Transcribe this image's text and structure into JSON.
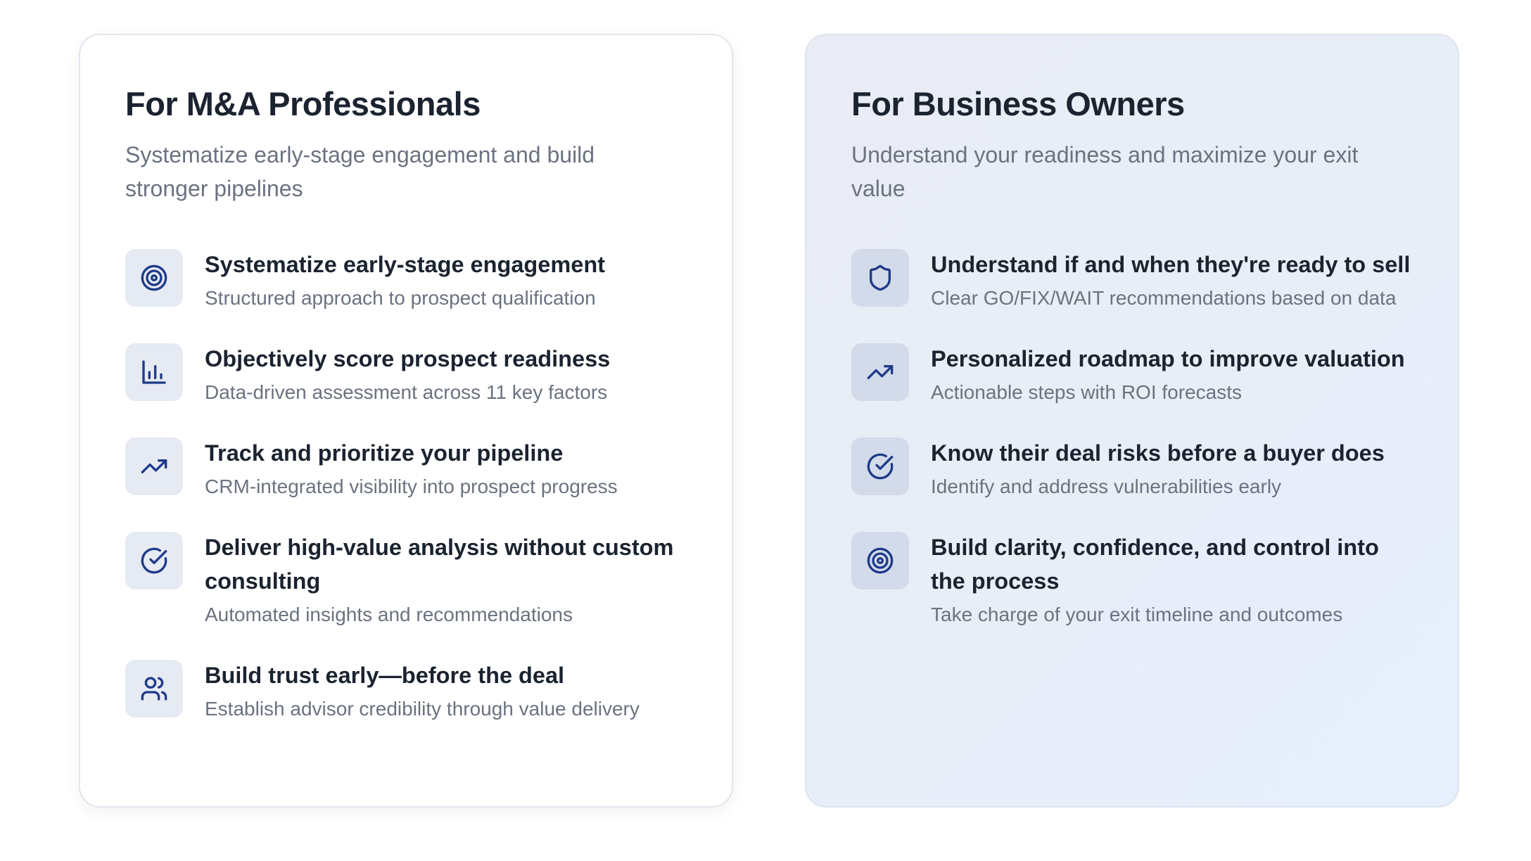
{
  "colors": {
    "icon": "#1e3a8a",
    "title": "#1b2330",
    "muted": "#6b7280",
    "border": "#e2e6ee"
  },
  "professionals": {
    "title": "For M&A Professionals",
    "subtitle": "Systematize early-stage engagement and build stronger pipelines",
    "features": [
      {
        "icon": "target-icon",
        "title": "Systematize early-stage engagement",
        "description": "Structured approach to prospect qualification"
      },
      {
        "icon": "bar-chart-icon",
        "title": "Objectively score prospect readiness",
        "description": "Data-driven assessment across 11 key factors"
      },
      {
        "icon": "trending-up-icon",
        "title": "Track and prioritize your pipeline",
        "description": "CRM-integrated visibility into prospect progress"
      },
      {
        "icon": "check-circle-icon",
        "title": "Deliver high-value analysis without custom consulting",
        "description": "Automated insights and recommendations"
      },
      {
        "icon": "users-icon",
        "title": "Build trust early—before the deal",
        "description": "Establish advisor credibility through value delivery"
      }
    ]
  },
  "owners": {
    "title": "For Business Owners",
    "subtitle": "Understand your readiness and maximize your exit value",
    "features": [
      {
        "icon": "shield-icon",
        "title": "Understand if and when they're ready to sell",
        "description": "Clear GO/FIX/WAIT recommendations based on data"
      },
      {
        "icon": "trending-up-icon",
        "title": "Personalized roadmap to improve valuation",
        "description": "Actionable steps with ROI forecasts"
      },
      {
        "icon": "check-circle-icon",
        "title": "Know their deal risks before a buyer does",
        "description": "Identify and address vulnerabilities early"
      },
      {
        "icon": "target-icon",
        "title": "Build clarity, confidence, and control into the process",
        "description": "Take charge of your exit timeline and outcomes"
      }
    ]
  }
}
